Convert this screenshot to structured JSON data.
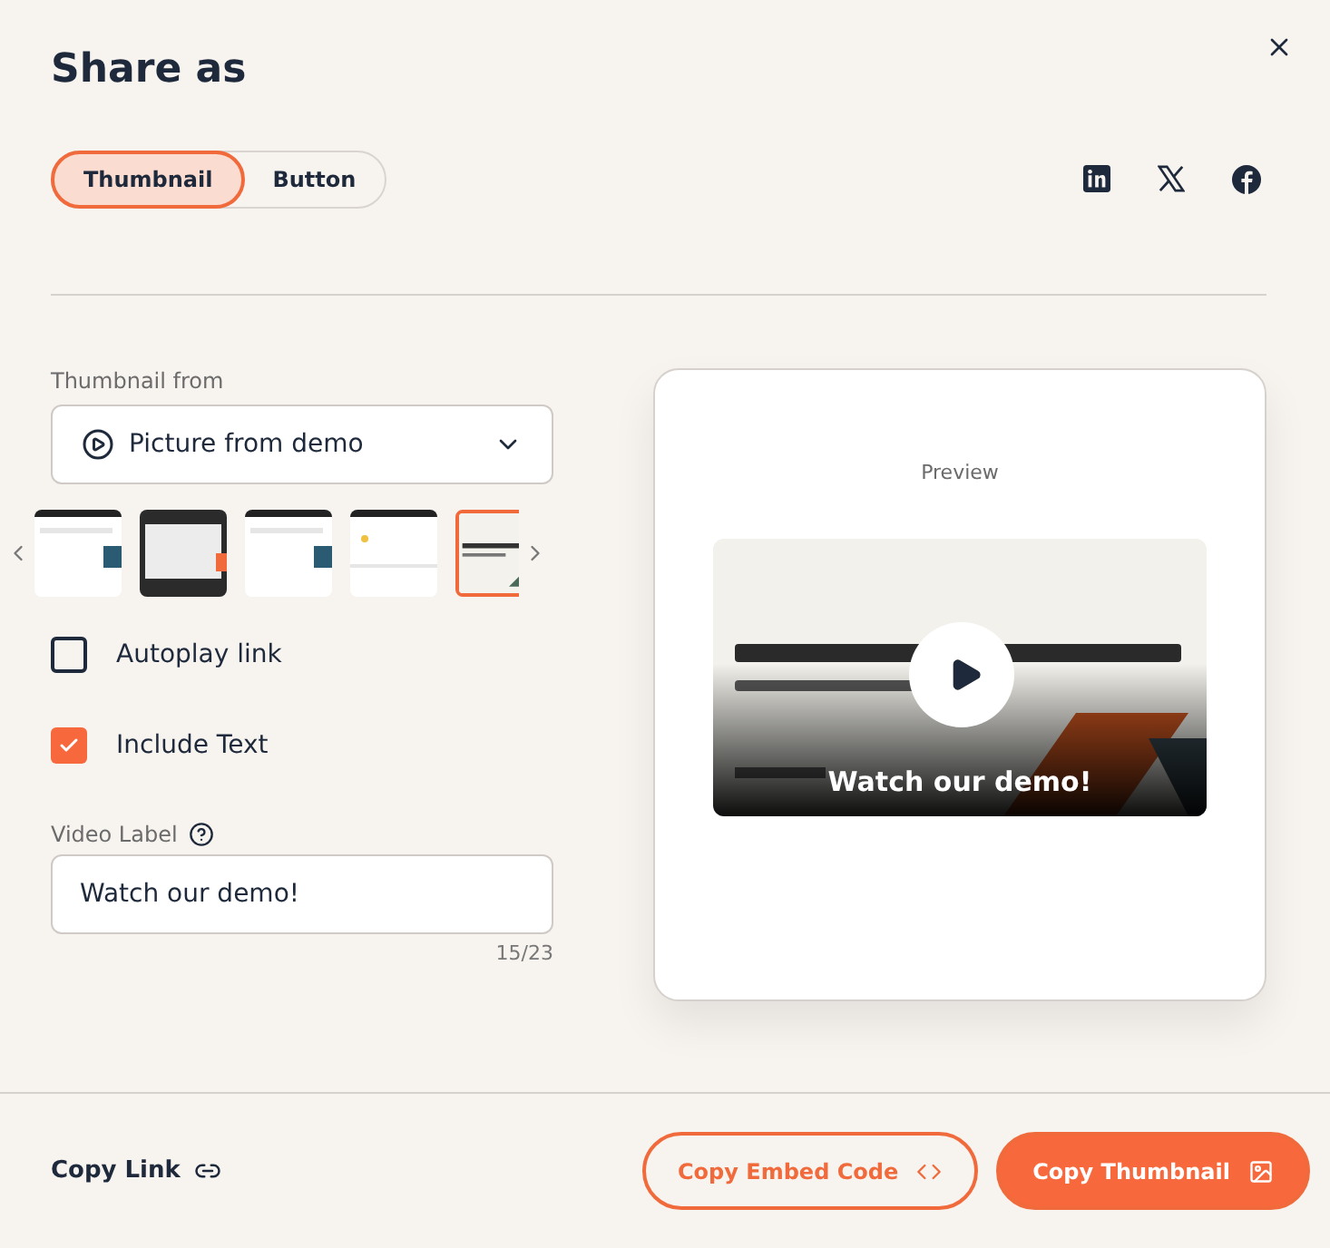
{
  "title": "Share as",
  "tabs": [
    {
      "label": "Thumbnail",
      "selected": true
    },
    {
      "label": "Button",
      "selected": false
    }
  ],
  "social": [
    {
      "kind": "linkedin"
    },
    {
      "kind": "x"
    },
    {
      "kind": "facebook"
    }
  ],
  "thumbnail_from": {
    "label": "Thumbnail from",
    "value": "Picture from demo"
  },
  "thumbnails": [
    {
      "kind": "light",
      "selected": false
    },
    {
      "kind": "dark",
      "selected": false
    },
    {
      "kind": "light",
      "selected": false
    },
    {
      "kind": "plain",
      "selected": false
    },
    {
      "kind": "slide",
      "selected": true
    }
  ],
  "options": [
    {
      "label": "Autoplay link",
      "checked": false
    },
    {
      "label": "Include Text",
      "checked": true
    }
  ],
  "video_label": {
    "label": "Video Label",
    "value": "Watch our demo!",
    "counter": "15/23"
  },
  "preview": {
    "title": "Preview",
    "overlay_text": "Watch our demo!"
  },
  "footer": {
    "link": "Copy Link",
    "buttons": [
      {
        "label": "Copy Embed Code",
        "kind": "outline"
      },
      {
        "label": "Copy Thumbnail",
        "kind": "filled"
      }
    ]
  }
}
